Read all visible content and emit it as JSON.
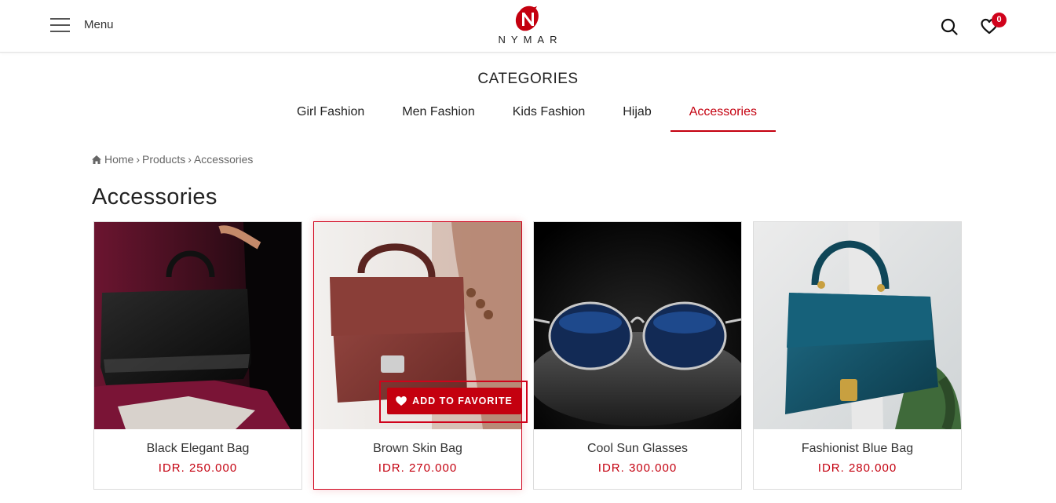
{
  "header": {
    "menu_label": "Menu",
    "logo_text": "NYMAR",
    "favorites_count": "0"
  },
  "categories": {
    "title": "CATEGORIES",
    "tabs": [
      {
        "label": "Girl Fashion",
        "active": false
      },
      {
        "label": "Men Fashion",
        "active": false
      },
      {
        "label": "Kids Fashion",
        "active": false
      },
      {
        "label": "Hijab",
        "active": false
      },
      {
        "label": "Accessories",
        "active": true
      }
    ]
  },
  "breadcrumb": {
    "home": "Home",
    "products": "Products",
    "current": "Accessories"
  },
  "page_title": "Accessories",
  "products": [
    {
      "name": "Black Elegant Bag",
      "price": "IDR. 250.000"
    },
    {
      "name": "Brown Skin Bag",
      "price": "IDR. 270.000"
    },
    {
      "name": "Cool Sun Glasses",
      "price": "IDR. 300.000"
    },
    {
      "name": "Fashionist Blue Bag",
      "price": "IDR. 280.000"
    }
  ],
  "favorite_button_label": "ADD TO FAVORITE",
  "colors": {
    "accent": "#c4000f",
    "badge": "#d0021b"
  }
}
